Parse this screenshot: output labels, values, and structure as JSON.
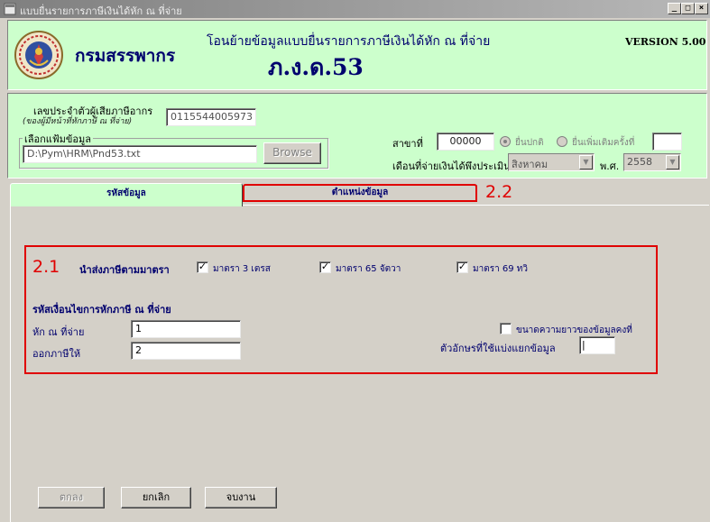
{
  "window": {
    "title": "แบบยื่นรายการภาษีเงินได้หัก ณ ที่จ่าย",
    "minimize": "_",
    "maximize": "□",
    "close": "×"
  },
  "header": {
    "department": "กรมสรรพากร",
    "title": "โอนย้ายข้อมูลแบบยื่นรายการภาษีเงินได้หัก ณ ที่จ่าย",
    "form_code": "ภ.ง.ด.53",
    "version": "VERSION 5.00"
  },
  "info": {
    "taxid_label": "เลขประจำตัวผู้เสียภาษีอากร",
    "taxid_sub": "(ของผู้มีหน้าที่หักภาษี ณ ที่จ่าย)",
    "taxid_value": "0115544005973",
    "file_group_label": "เลือกแฟ้มข้อมูล",
    "file_path": "D:\\Pym\\HRM\\Pnd53.txt",
    "browse_label": "Browse",
    "branch_label": "สาขาที่",
    "branch_value": "00000",
    "radio_normal": "ยื่นปกติ",
    "radio_additional": "ยื่นเพิ่มเติมครั้งที่",
    "additional_value": "",
    "month_label": "เดือนที่จ่ายเงินได้พึงประเมิน",
    "month_value": "สิงหาคม",
    "year_label": "พ.ศ.",
    "year_value": "2558"
  },
  "tabs": {
    "codes": "รหัสข้อมูล",
    "positions": "ตำแหน่งข้อมูล"
  },
  "annotations": {
    "a21": "2.1",
    "a22": "2.2"
  },
  "section": {
    "send_by_label": "นำส่งภาษีตามมาตรา",
    "cb1": "มาตรา 3 เตรส",
    "cb2": "มาตรา 65 จัตวา",
    "cb3": "มาตรา 69 ทวิ",
    "condition_label": "รหัสเงื่อนไขการหักภาษี ณ ที่จ่าย",
    "withhold_label": "หัก ณ ที่จ่าย",
    "withhold_value": "1",
    "issue_label": "ออกภาษีให้",
    "issue_value": "2",
    "fixed_length_label": "ขนาดความยาวของข้อมูลคงที่",
    "delimiter_label": "ตัวอักษรที่ใช้แบ่งแยกข้อมูล",
    "delimiter_value": "|"
  },
  "buttons": {
    "ok": "ตกลง",
    "cancel": "ยกเลิก",
    "exit": "จบงาน"
  },
  "colors": {
    "panel_green": "#ccffcc",
    "form_gray": "#d4d0c8",
    "annotation_red": "#e00000",
    "title_navy": "#00006e"
  }
}
